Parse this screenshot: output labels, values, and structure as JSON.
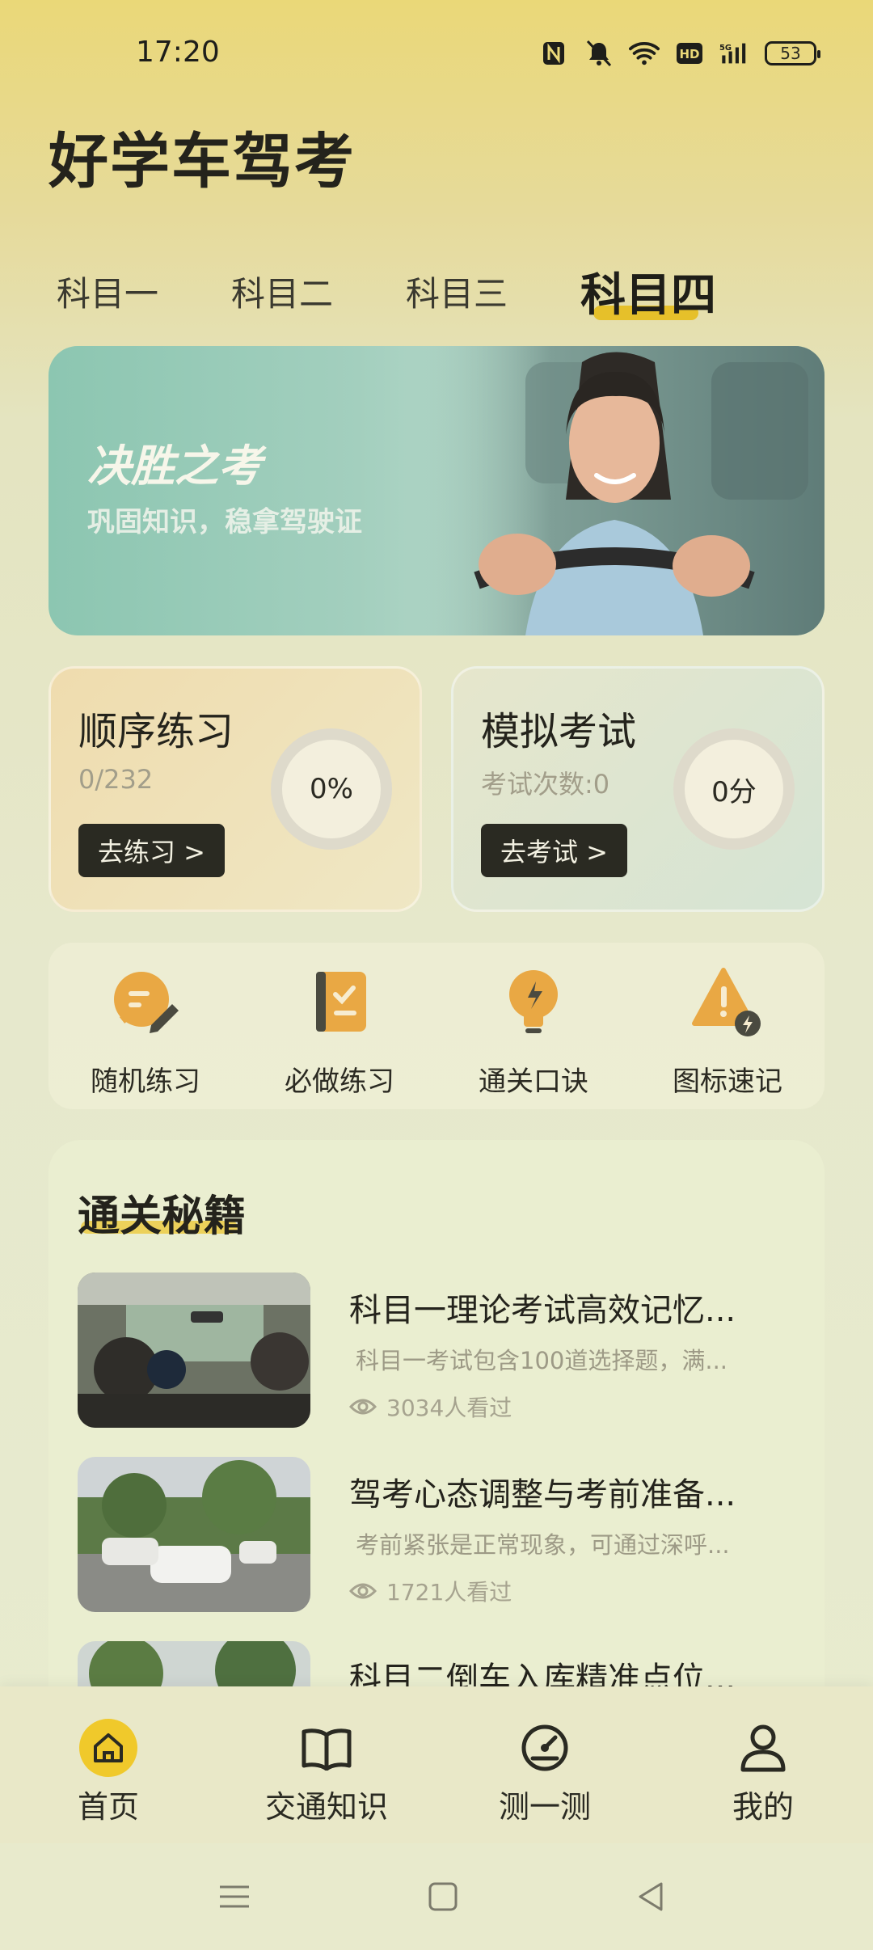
{
  "status_bar": {
    "time": "17:20",
    "battery": "53"
  },
  "app": {
    "title": "好学车驾考"
  },
  "tabs": [
    {
      "label": "科目一"
    },
    {
      "label": "科目二"
    },
    {
      "label": "科目三"
    },
    {
      "label": "科目四",
      "active": true
    }
  ],
  "banner": {
    "title": "决胜之考",
    "subtitle": "巩固知识，稳拿驾驶证"
  },
  "practice_card": {
    "title": "顺序练习",
    "progress": "0/232",
    "percent": "0%",
    "button": "去练习 >"
  },
  "exam_card": {
    "title": "模拟考试",
    "attempts": "考试次数:0",
    "score": "0分",
    "button": "去考试 >"
  },
  "quick_actions": [
    {
      "label": "随机练习",
      "icon": "pencil-chat-icon"
    },
    {
      "label": "必做练习",
      "icon": "checklist-book-icon"
    },
    {
      "label": "通关口诀",
      "icon": "lightbulb-icon"
    },
    {
      "label": "图标速记",
      "icon": "warning-sign-icon"
    }
  ],
  "tips": {
    "title": "通关秘籍",
    "articles": [
      {
        "title": "科目一理论考试高效记忆...",
        "desc": "科目一考试包含100道选择题，满...",
        "views": "3034人看过"
      },
      {
        "title": "驾考心态调整与考前准备...",
        "desc": "考前紧张是正常现象，可通过深呼...",
        "views": "1721人看过"
      },
      {
        "title": "科目二倒车入库精准点位...",
        "desc": "",
        "views": ""
      }
    ]
  },
  "bottom_nav": [
    {
      "label": "首页",
      "icon": "home-icon",
      "active": true
    },
    {
      "label": "交通知识",
      "icon": "book-icon"
    },
    {
      "label": "测一测",
      "icon": "gauge-icon"
    },
    {
      "label": "我的",
      "icon": "user-icon"
    }
  ],
  "colors": {
    "accent": "#f0c92b",
    "dark": "#2a2a22",
    "banner": "#8cc6b1"
  }
}
